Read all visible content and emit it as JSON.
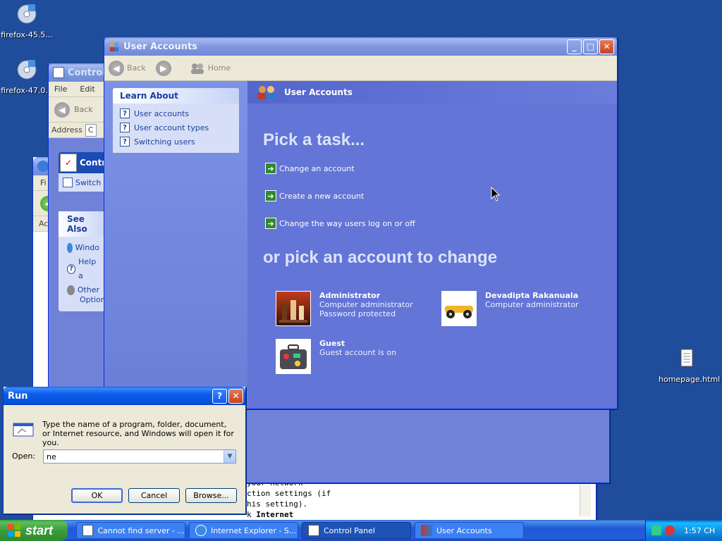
{
  "desktop": {
    "icons": [
      {
        "label": "firefox-45.5..."
      },
      {
        "label": "firefox-47.0..."
      },
      {
        "label": "homepage.html"
      }
    ]
  },
  "back_windows": {
    "control_panel": {
      "title": "Control P",
      "menu": [
        "File",
        "Edit"
      ],
      "back_label": "Back",
      "address_label": "Address",
      "address_value": "C",
      "header_label": "Contr",
      "switch_label": "Switch",
      "see_also_title": "See Also",
      "see_also_items": [
        "Windo",
        "Help a",
        "Other",
        "Option"
      ]
    },
    "ie": {
      "menu_partial": "Fi",
      "address_partial": "Ac",
      "error_lines": [
        "your network",
        "ction settings (if",
        "his setting).",
        "k "
      ],
      "error_bold": "Internet"
    }
  },
  "user_accounts": {
    "title": "User Accounts",
    "toolbar": {
      "back": "Back",
      "home": "Home"
    },
    "learn_about": {
      "title": "Learn About",
      "items": [
        "User accounts",
        "User account types",
        "Switching users"
      ]
    },
    "header": "User Accounts",
    "pick_task_title": "Pick a task...",
    "tasks": [
      "Change an account",
      "Create a new account",
      "Change the way users log on or off"
    ],
    "pick_account_title": "or pick an account to change",
    "accounts": [
      {
        "name": "Administrator",
        "line1": "Computer administrator",
        "line2": "Password protected"
      },
      {
        "name": "Devadipta Rakanuala",
        "line1": "Computer administrator",
        "line2": ""
      },
      {
        "name": "Guest",
        "line1": "Guest account is on",
        "line2": ""
      }
    ]
  },
  "run_dialog": {
    "title": "Run",
    "description": "Type the name of a program, folder, document, or Internet resource, and Windows will open it for you.",
    "open_label": "Open:",
    "open_value": "ne",
    "ok": "OK",
    "cancel": "Cancel",
    "browse": "Browse..."
  },
  "taskbar": {
    "start": "start",
    "buttons": [
      "Cannot find server - ...",
      "Internet Explorer - S...",
      "Control Panel",
      "User Accounts"
    ],
    "clock": "1:57 CH"
  }
}
